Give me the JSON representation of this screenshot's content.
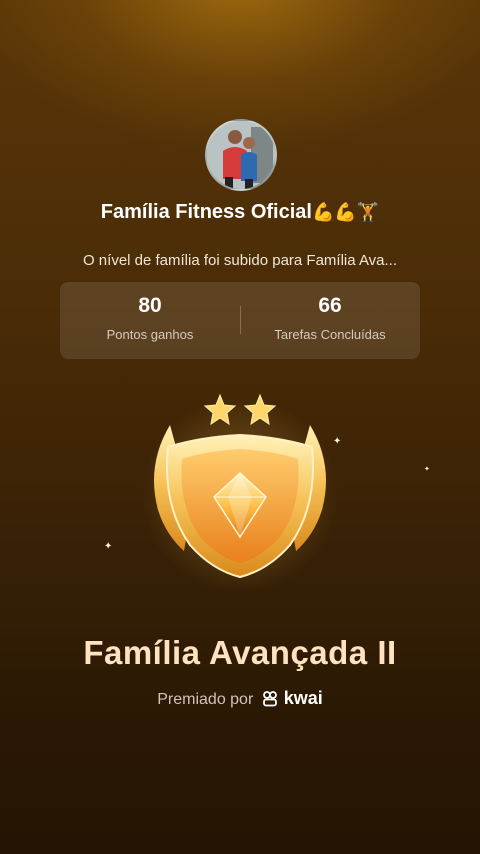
{
  "profile": {
    "group_name": "Família Fitness Oficial",
    "group_name_emojis": "💪💪🏋",
    "level_message": "O nível de família foi subido para Família Ava..."
  },
  "stats": [
    {
      "value": "80",
      "label": "Pontos ganhos"
    },
    {
      "value": "66",
      "label": "Tarefas Concluídas"
    }
  ],
  "badge": {
    "title": "Família Avançada II",
    "stars": 2
  },
  "awarded": {
    "prefix": "Premiado por",
    "brand": "kwai"
  }
}
